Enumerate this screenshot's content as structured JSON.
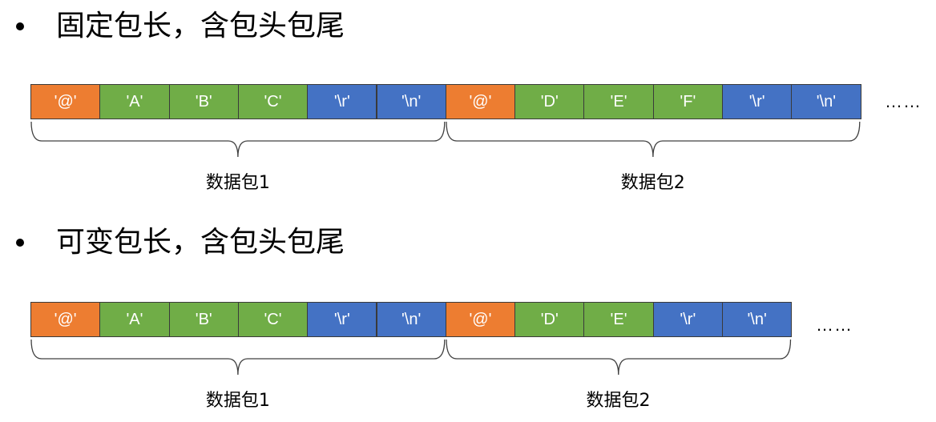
{
  "sections": [
    {
      "heading": "固定包长，含包头包尾",
      "cells": [
        {
          "label": "'@'",
          "role": "header"
        },
        {
          "label": "'A'",
          "role": "data"
        },
        {
          "label": "'B'",
          "role": "data"
        },
        {
          "label": "'C'",
          "role": "data"
        },
        {
          "label": "'\\r'",
          "role": "tail"
        },
        {
          "label": "'\\n'",
          "role": "tail"
        },
        {
          "label": "'@'",
          "role": "header"
        },
        {
          "label": "'D'",
          "role": "data"
        },
        {
          "label": "'E'",
          "role": "data"
        },
        {
          "label": "'F'",
          "role": "data"
        },
        {
          "label": "'\\r'",
          "role": "tail"
        },
        {
          "label": "'\\n'",
          "role": "tail"
        }
      ],
      "ellipsis": "……",
      "packets": [
        {
          "label": "数据包1",
          "cell_count": 6
        },
        {
          "label": "数据包2",
          "cell_count": 6
        }
      ]
    },
    {
      "heading": "可变包长，含包头包尾",
      "cells": [
        {
          "label": "'@'",
          "role": "header"
        },
        {
          "label": "'A'",
          "role": "data"
        },
        {
          "label": "'B'",
          "role": "data"
        },
        {
          "label": "'C'",
          "role": "data"
        },
        {
          "label": "'\\r'",
          "role": "tail"
        },
        {
          "label": "'\\n'",
          "role": "tail"
        },
        {
          "label": "'@'",
          "role": "header"
        },
        {
          "label": "'D'",
          "role": "data"
        },
        {
          "label": "'E'",
          "role": "data"
        },
        {
          "label": "'\\r'",
          "role": "tail"
        },
        {
          "label": "'\\n'",
          "role": "tail"
        }
      ],
      "ellipsis": "……",
      "packets": [
        {
          "label": "数据包1",
          "cell_count": 6
        },
        {
          "label": "数据包2",
          "cell_count": 5
        }
      ]
    }
  ],
  "colors": {
    "header": "#ED7D31",
    "data": "#70AD47",
    "tail": "#4472C4",
    "brace": "#404040"
  }
}
